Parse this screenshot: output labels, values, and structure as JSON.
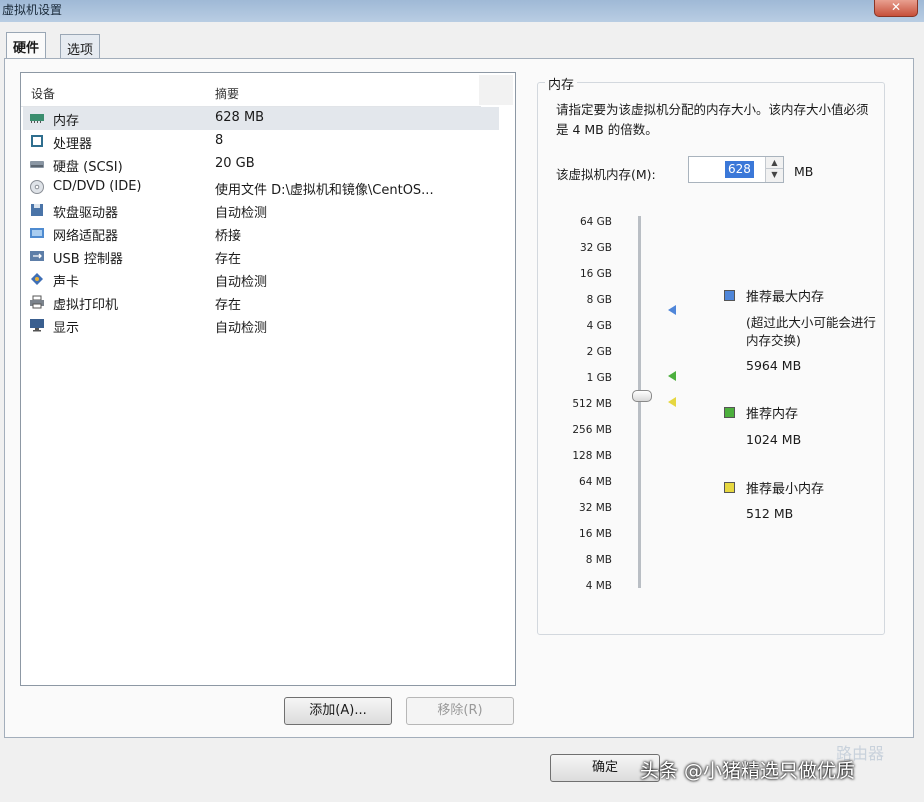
{
  "window": {
    "title": "虚拟机设置",
    "close_label": "✕"
  },
  "tabs": [
    {
      "label": "硬件",
      "active": true
    },
    {
      "label": "选项",
      "active": false
    }
  ],
  "device_list": {
    "columns": {
      "device": "设备",
      "summary": "摘要"
    },
    "rows": [
      {
        "name": "内存",
        "summary": "628 MB",
        "icon": "memory-icon",
        "selected": true
      },
      {
        "name": "处理器",
        "summary": "8",
        "icon": "processor-icon"
      },
      {
        "name": "硬盘 (SCSI)",
        "summary": "20 GB",
        "icon": "harddisk-icon"
      },
      {
        "name": "CD/DVD (IDE)",
        "summary": "使用文件 D:\\虚拟机和镜像\\CentOS...",
        "icon": "cd-icon"
      },
      {
        "name": "软盘驱动器",
        "summary": "自动检测",
        "icon": "floppy-icon"
      },
      {
        "name": "网络适配器",
        "summary": "桥接",
        "icon": "network-icon"
      },
      {
        "name": "USB 控制器",
        "summary": "存在",
        "icon": "usb-icon"
      },
      {
        "name": "声卡",
        "summary": "自动检测",
        "icon": "sound-icon"
      },
      {
        "name": "虚拟打印机",
        "summary": "存在",
        "icon": "printer-icon"
      },
      {
        "name": "显示",
        "summary": "自动检测",
        "icon": "display-icon"
      }
    ]
  },
  "buttons": {
    "add": "添加(A)...",
    "remove": "移除(R)",
    "ok": "确定"
  },
  "memory_panel": {
    "group_title": "内存",
    "description": "请指定要为该虚拟机分配的内存大小。该内存大小值必须是 4 MB 的倍数。",
    "input_label": "该虚拟机内存(M):",
    "input_value": "628",
    "unit": "MB",
    "scale_ticks": [
      "64 GB",
      "32 GB",
      "16 GB",
      "8 GB",
      "4 GB",
      "2 GB",
      "1 GB",
      "512 MB",
      "256 MB",
      "128 MB",
      "64 MB",
      "32 MB",
      "16 MB",
      "8 MB",
      "4 MB"
    ],
    "legend": [
      {
        "label": "推荐最大内存",
        "note": "(超过此大小可能会进行内存交换)",
        "value": "5964 MB",
        "color": "#4f86d9"
      },
      {
        "label": "推荐内存",
        "value": "1024 MB",
        "color": "#4caf3d"
      },
      {
        "label": "推荐最小内存",
        "value": "512 MB",
        "color": "#e6d740"
      }
    ]
  },
  "watermark": {
    "text": "头条 @小猪精选只做优质",
    "corner": "路由器"
  },
  "colors": {
    "selected_row": "#e3e7ec",
    "input_highlight": "#3b78d8"
  }
}
